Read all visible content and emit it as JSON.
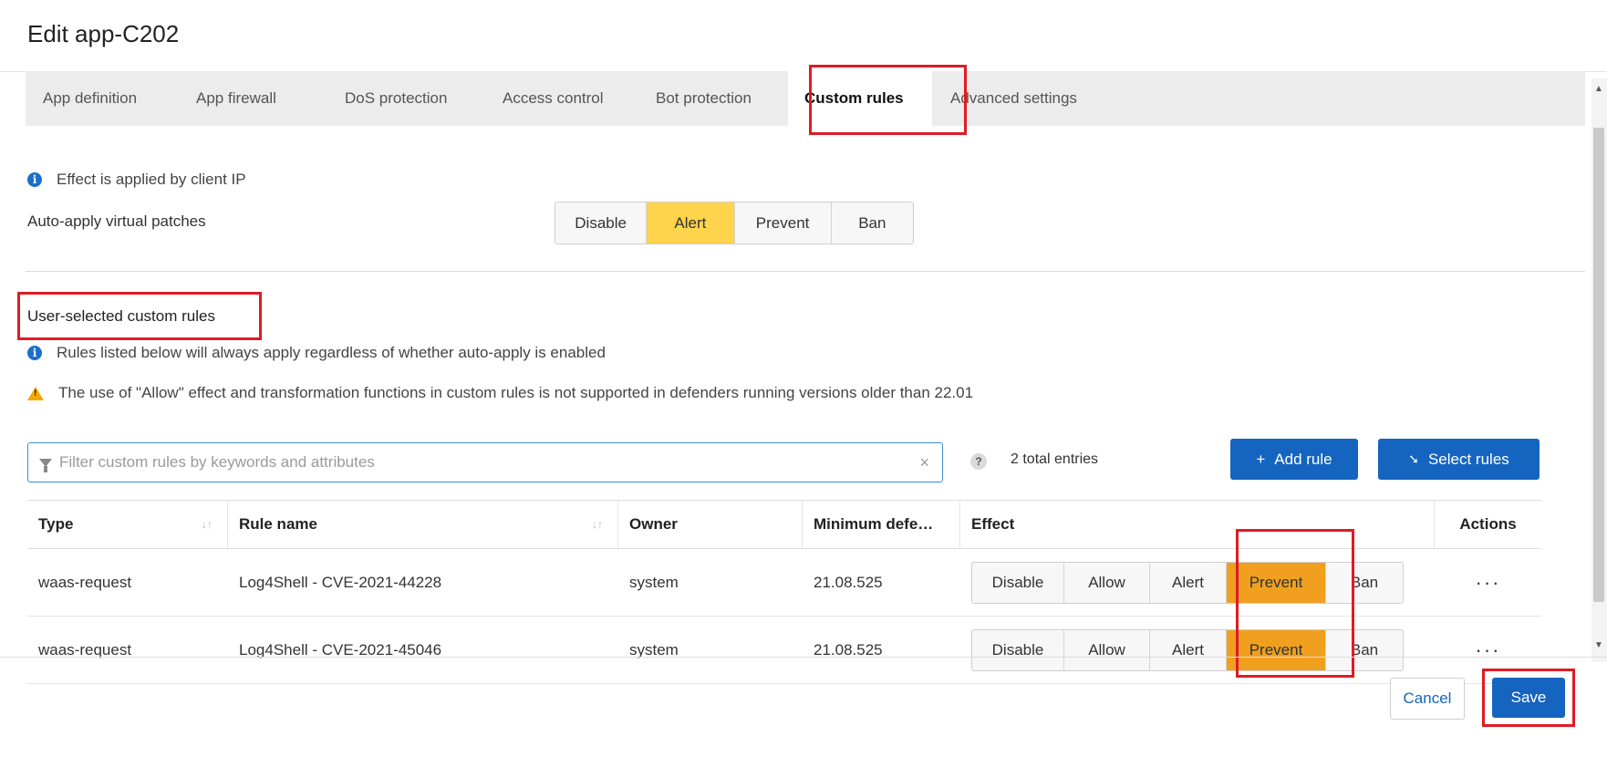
{
  "dialog": {
    "title": "Edit app-C202"
  },
  "tabs": [
    {
      "label": "App definition",
      "active": false
    },
    {
      "label": "App firewall",
      "active": false
    },
    {
      "label": "DoS protection",
      "active": false
    },
    {
      "label": "Access control",
      "active": false
    },
    {
      "label": "Bot protection",
      "active": false
    },
    {
      "label": "Custom rules",
      "active": true
    },
    {
      "label": "Advanced settings",
      "active": false
    }
  ],
  "virtual_patches": {
    "info_text": "Effect is applied by client IP",
    "label": "Auto-apply virtual patches",
    "options": [
      "Disable",
      "Alert",
      "Prevent",
      "Ban"
    ],
    "selected": "Alert"
  },
  "custom_rules": {
    "heading": "User-selected custom rules",
    "info_text": "Rules listed below will always apply regardless of whether auto-apply is enabled",
    "warning_text": "The use of \"Allow\" effect and transformation functions in custom rules is not supported in defenders running versions older than 22.01"
  },
  "toolbar": {
    "filter_placeholder": "Filter custom rules by keywords and attributes",
    "filter_value": "",
    "total_entries": "2 total entries",
    "add_rule_label": "Add rule",
    "select_rules_label": "Select rules"
  },
  "table": {
    "columns": [
      "Type",
      "Rule name",
      "Owner",
      "Minimum defe…",
      "Effect",
      "Actions"
    ],
    "effect_options": [
      "Disable",
      "Allow",
      "Alert",
      "Prevent",
      "Ban"
    ],
    "rows": [
      {
        "type": "waas-request",
        "rule_name": "Log4Shell - CVE-2021-44228",
        "owner": "system",
        "min_defender": "21.08.525",
        "effect": "Prevent",
        "actions": "···"
      },
      {
        "type": "waas-request",
        "rule_name": "Log4Shell - CVE-2021-45046",
        "owner": "system",
        "min_defender": "21.08.525",
        "effect": "Prevent",
        "actions": "···"
      }
    ]
  },
  "footer": {
    "cancel_label": "Cancel",
    "save_label": "Save"
  },
  "colors": {
    "accent_blue": "#1565c0",
    "selected_yellow": "#fdd44b",
    "selected_orange": "#f0a01e",
    "highlight_red": "#e01b24"
  }
}
